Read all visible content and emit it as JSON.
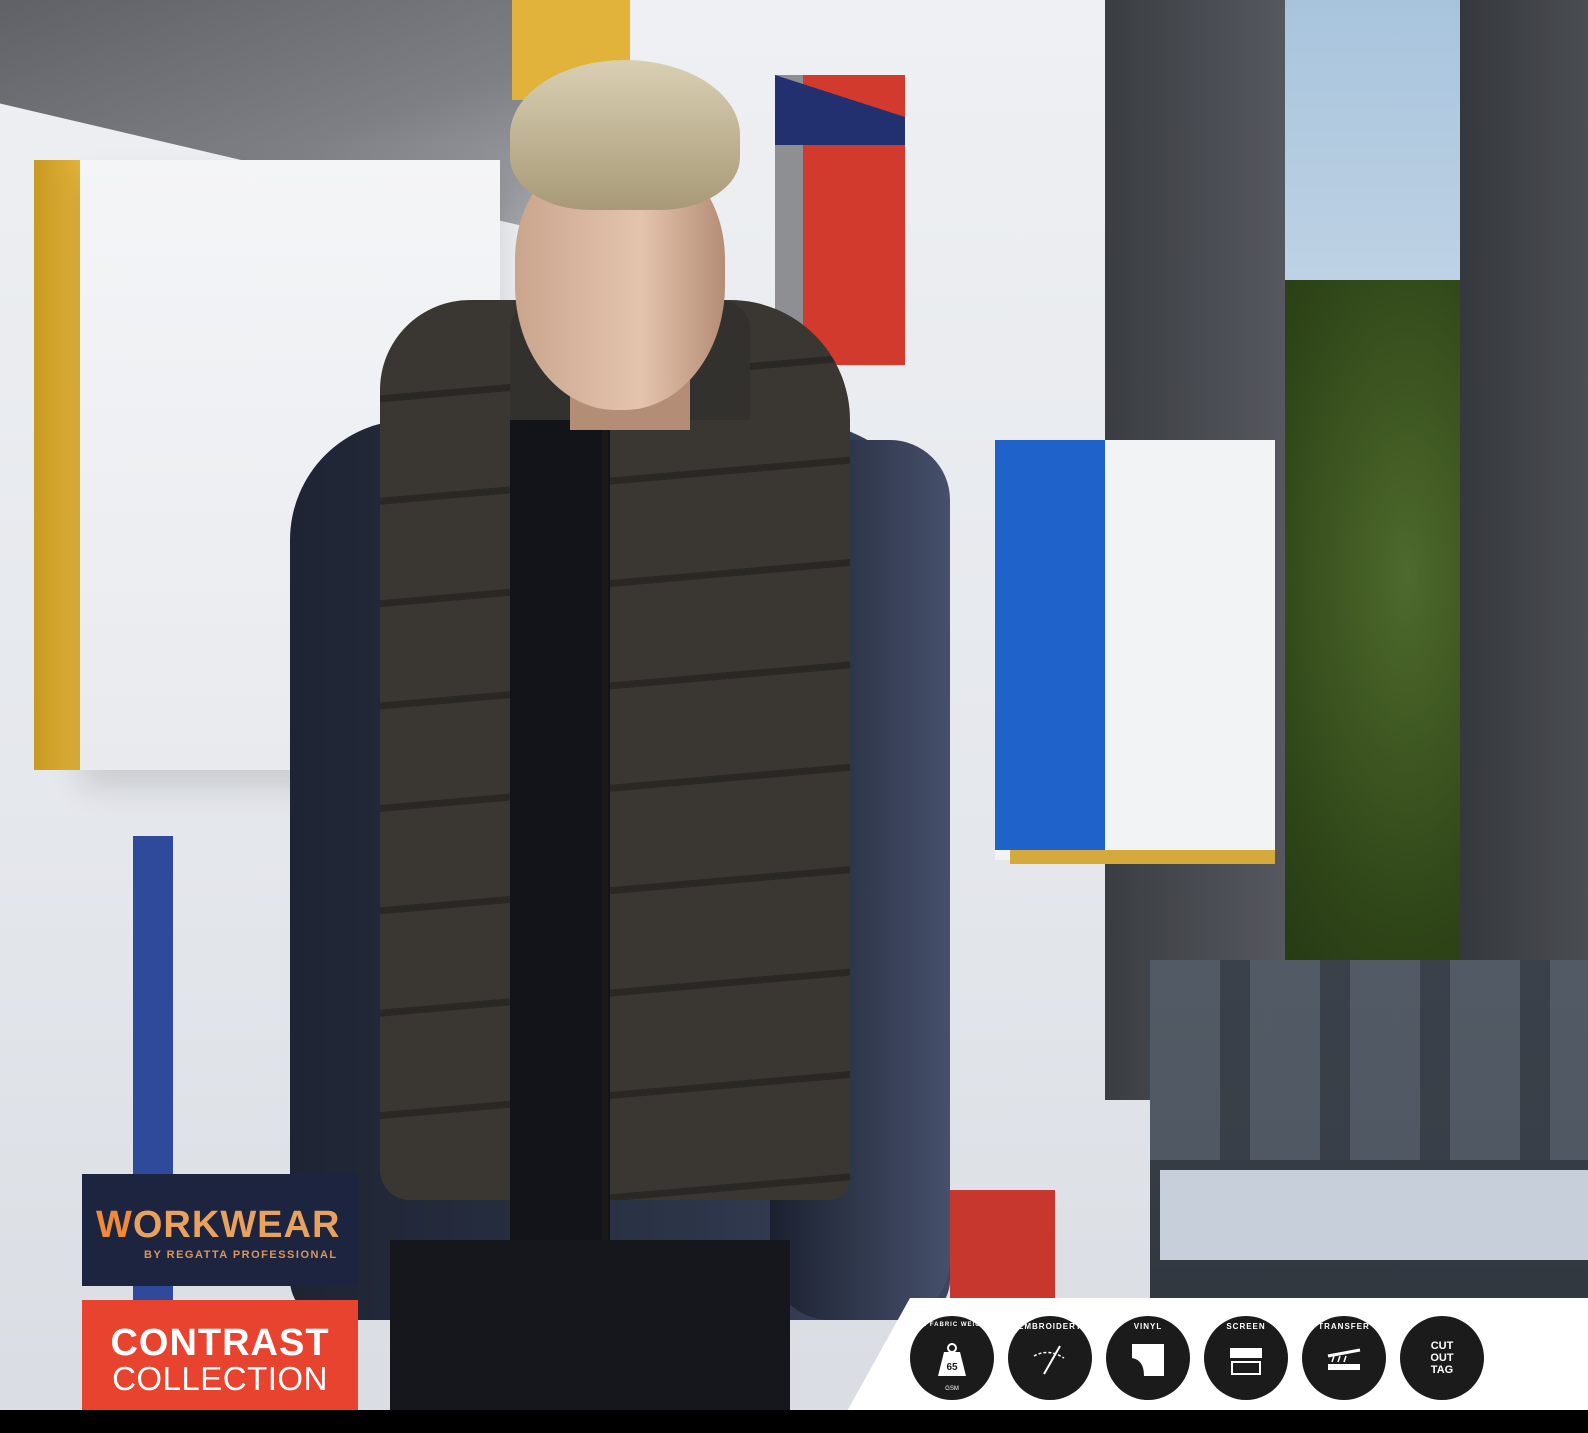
{
  "workwear_logo": {
    "first_letter": "W",
    "rest": "ORKWEAR",
    "subtitle": "BY REGATTA PROFESSIONAL"
  },
  "contrast_logo": {
    "title": "CONTRAST",
    "subtitle": "COLLECTION"
  },
  "icons": [
    {
      "name": "fabric-weight-icon",
      "label": "MIN FABRIC WEIGHT",
      "value": "65",
      "unit": "GSM"
    },
    {
      "name": "embroidery-icon",
      "label": "EMBROIDERY"
    },
    {
      "name": "vinyl-icon",
      "label": "VINYL"
    },
    {
      "name": "screen-icon",
      "label": "SCREEN"
    },
    {
      "name": "transfer-icon",
      "label": "TRANSFER"
    },
    {
      "name": "cut-out-tag-icon",
      "label": "CUT OUT TAG",
      "line1": "CUT",
      "line2": "OUT",
      "line3": "TAG"
    }
  ],
  "colors": {
    "workwear_bg": "#1c2440",
    "workwear_accent": "#f08a3a",
    "contrast_bg": "#e8432e",
    "icon_bg": "#1b1b1b"
  }
}
